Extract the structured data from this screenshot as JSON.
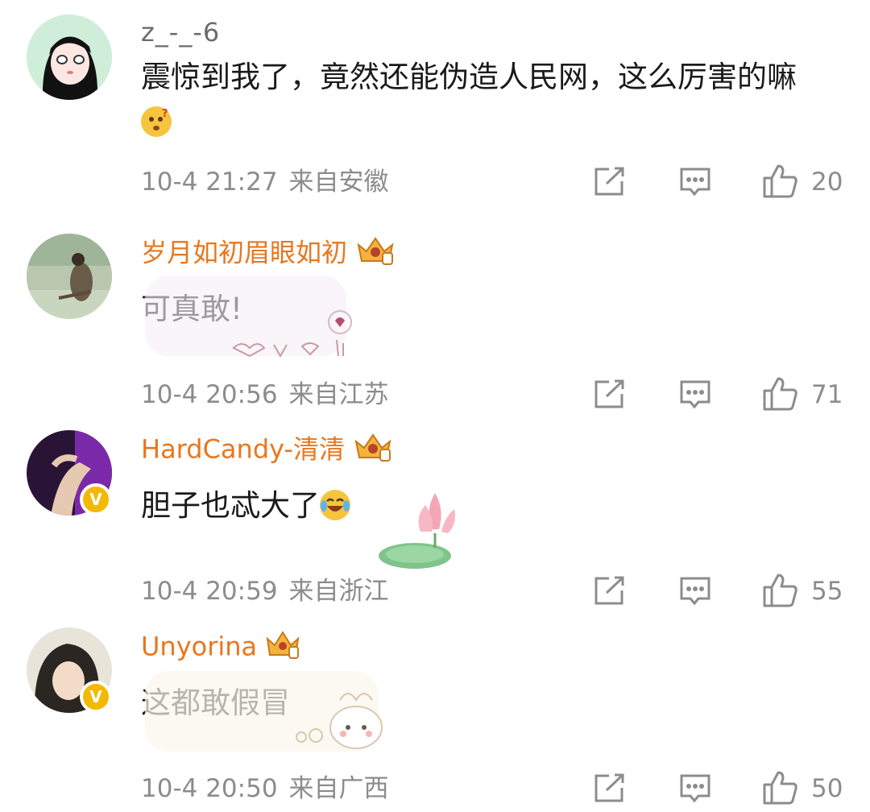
{
  "comments": [
    {
      "username": "z_-_-6",
      "text": "震惊到我了，竟然还能伪造人民网，这么厉害的嘛",
      "emoji": "thinking-emoji",
      "time": "10-4 21:27",
      "location": "来自安徽",
      "likes": "20",
      "member": false,
      "verified": false
    },
    {
      "username": "岁月如初眉眼如初",
      "text": "可真敢!",
      "time": "10-4 20:56",
      "location": "来自江苏",
      "likes": "71",
      "member": true,
      "verified": false
    },
    {
      "username": "HardCandy-清清",
      "text": "胆子也忒大了",
      "emoji": "laugh-cry-emoji",
      "time": "10-4 20:59",
      "location": "来自浙江",
      "likes": "55",
      "member": true,
      "verified": true
    },
    {
      "username": "Unyorina",
      "text": "这都敢假冒",
      "time": "10-4 20:50",
      "location": "来自广西",
      "likes": "50",
      "member": true,
      "verified": true
    }
  ],
  "icons": {
    "share": "share-icon",
    "reply": "comment-icon",
    "like": "thumbs-up-icon",
    "verified": "verified-v-icon"
  },
  "colors": {
    "member_name": "#e8771e",
    "meta_gray": "#8c8c8c",
    "verified_badge": "#f5b800"
  }
}
